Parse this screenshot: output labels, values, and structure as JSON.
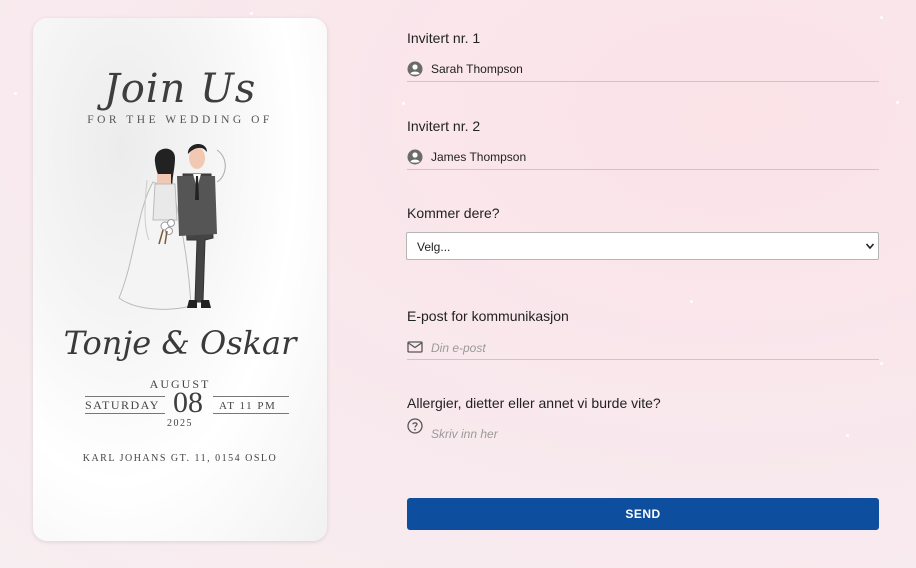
{
  "invitation": {
    "headline": "Join Us",
    "subline": "FOR THE WEDDING OF",
    "names": "Tonje  & Oskar",
    "month": "AUGUST",
    "weekday": "SATURDAY",
    "day": "08",
    "time": "AT 11 PM",
    "year": "2025",
    "address": "KARL JOHANS GT. 11, 0154 OSLO"
  },
  "form": {
    "guest1": {
      "label": "Invitert nr. 1",
      "value": "Sarah Thompson",
      "icon": "account-circle-icon"
    },
    "guest2": {
      "label": "Invitert nr. 2",
      "value": "James Thompson",
      "icon": "account-circle-icon"
    },
    "attending": {
      "label": "Kommer dere?",
      "selected": "Velg..."
    },
    "email": {
      "label": "E-post for kommunikasjon",
      "placeholder": "Din e-post",
      "icon": "mail-icon"
    },
    "notes": {
      "label": "Allergier, dietter eller annet vi burde vite?",
      "placeholder": "Skriv inn her",
      "icon": "help-circle-icon"
    },
    "submit_label": "SEND"
  },
  "colors": {
    "accent": "#0d4f9e",
    "background": "#f9e7ec"
  }
}
